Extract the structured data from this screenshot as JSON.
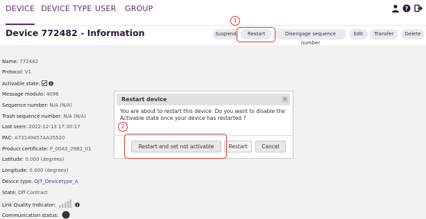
{
  "nav": {
    "tabs": [
      "DEVICE",
      "DEVICE TYPE",
      "USER",
      "GROUP"
    ],
    "icons": [
      "user-icon",
      "help-icon",
      "logout-icon"
    ]
  },
  "header": {
    "title": "Device 772482 - Information",
    "actions": [
      "Suspend",
      "Restart",
      "Disengage sequence number",
      "Edit",
      "Transfer",
      "Delete"
    ]
  },
  "details": [
    {
      "label": "Name:",
      "value": "772482"
    },
    {
      "label": "Protocol:",
      "value": "V1"
    },
    {
      "label": "Activable state:",
      "value": ""
    },
    {
      "label": "Message modulo:",
      "value": "4096"
    },
    {
      "label": "Sequence number:",
      "value": "N/A (N/A)"
    },
    {
      "label": "Trash sequence number:",
      "value": "N/A (N/A)"
    },
    {
      "label": "Last seen:",
      "value": "2022-12-13 17:30:17"
    },
    {
      "label": "PAC:",
      "value": "A73149457AA35520"
    },
    {
      "label": "Product certificate:",
      "value": "P_00A3_29B2_01"
    },
    {
      "label": "Latitude:",
      "value": "0.000 (degrees)"
    },
    {
      "label": "Longitude:",
      "value": "0.000 (degrees)"
    },
    {
      "label": "Device type:",
      "value": "OJT_Devicetype_A"
    },
    {
      "label": "State:",
      "value": "Off Contract"
    },
    {
      "label": "Link Quality Indicator:",
      "value": ""
    },
    {
      "label": "Communication status:",
      "value": ""
    }
  ],
  "modal": {
    "title": "Restart device",
    "close": "×",
    "message": "You are about to restart this device. Do you want to disable the Activable state once your device has restarted ?",
    "buttons": [
      "Restart and set not activable",
      "Restart",
      "Cancel"
    ]
  },
  "annotations": [
    "1",
    "2"
  ],
  "colors": {
    "accent": "#5a2a73",
    "annotation": "#dd3333",
    "link": "#3b3b9c"
  }
}
